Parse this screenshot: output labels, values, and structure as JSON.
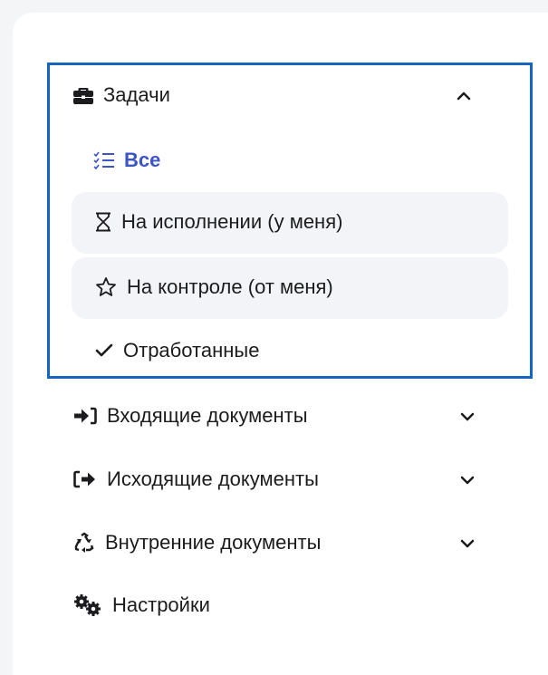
{
  "menu": {
    "tasks": {
      "label": "Задачи",
      "icon": "briefcase-icon",
      "expanded": true,
      "children": [
        {
          "label": "Все",
          "icon": "checklist-icon",
          "active": true
        },
        {
          "label": "На исполнении (у меня)",
          "icon": "hourglass-icon"
        },
        {
          "label": "На контроле (от меня)",
          "icon": "star-icon"
        },
        {
          "label": "Отработанные",
          "icon": "check-icon"
        }
      ]
    },
    "incoming": {
      "label": "Входящие документы",
      "icon": "sign-in-icon"
    },
    "outgoing": {
      "label": "Исходящие документы",
      "icon": "sign-out-icon"
    },
    "internal": {
      "label": "Внутренние документы",
      "icon": "recycle-icon"
    },
    "settings": {
      "label": "Настройки",
      "icon": "gears-icon"
    }
  },
  "colors": {
    "accent": "#3d55c4",
    "focus_border": "#1565c0",
    "hover_bg": "#f3f4f7"
  }
}
